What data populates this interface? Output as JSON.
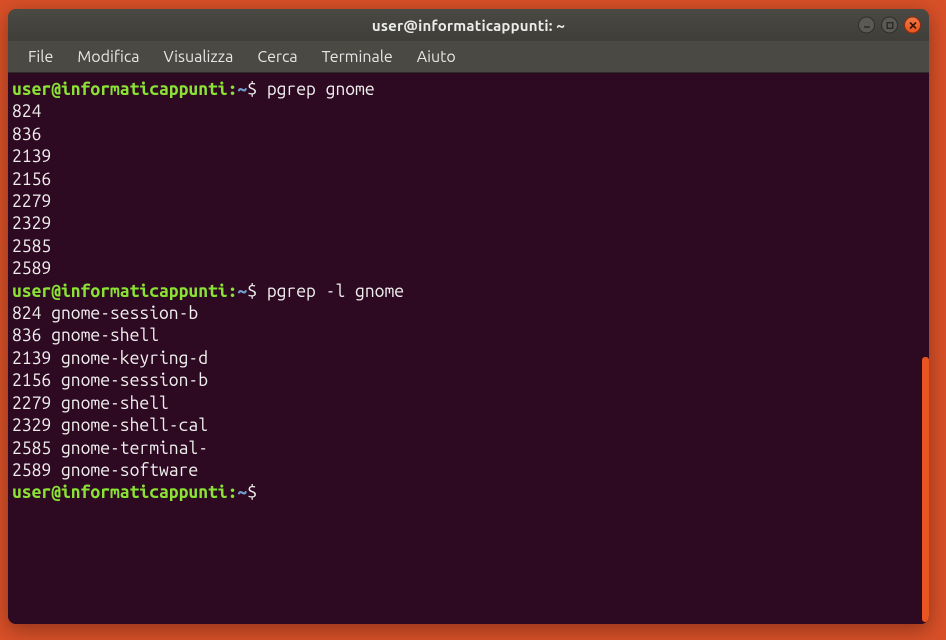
{
  "window": {
    "title": "user@informaticappunti: ~"
  },
  "menubar": {
    "items": [
      "File",
      "Modifica",
      "Visualizza",
      "Cerca",
      "Terminale",
      "Aiuto"
    ]
  },
  "prompt": {
    "user_host": "user@informaticappunti",
    "sep": ":",
    "path": "~",
    "dollar": "$"
  },
  "commands": {
    "cmd1": "pgrep gnome",
    "cmd2": "pgrep -l gnome",
    "cmd3": ""
  },
  "output1": [
    "824",
    "836",
    "2139",
    "2156",
    "2279",
    "2329",
    "2585",
    "2589"
  ],
  "output2": [
    "824 gnome-session-b",
    "836 gnome-shell",
    "2139 gnome-keyring-d",
    "2156 gnome-session-b",
    "2279 gnome-shell",
    "2329 gnome-shell-cal",
    "2585 gnome-terminal-",
    "2589 gnome-software"
  ],
  "colors": {
    "accent": "#e95420",
    "prompt_green": "#8ae234",
    "prompt_blue": "#729fcf",
    "terminal_bg": "#2d0922",
    "desktop_bg": "#d85028"
  }
}
